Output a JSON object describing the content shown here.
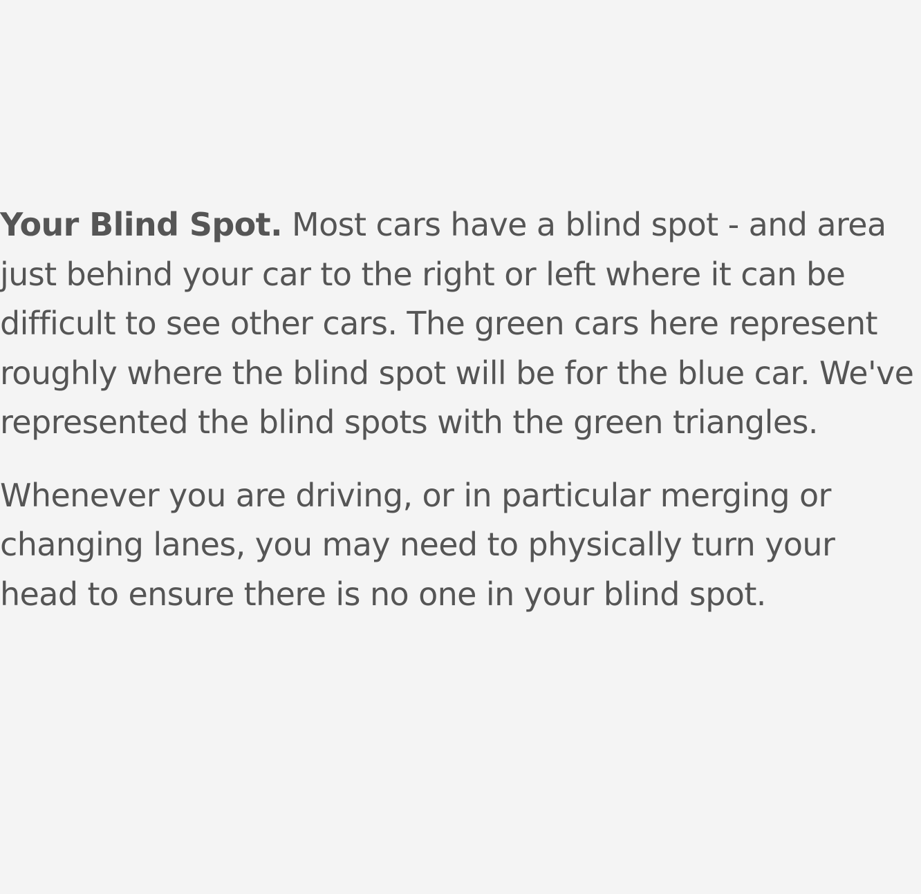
{
  "article": {
    "paragraph1": {
      "heading": "Your Blind Spot.",
      "text": "Most cars have a blind spot - and area just behind your car to the right or left where it can be difficult to see other cars. The green cars here represent roughly where the blind spot will be for the blue car. We've represented the blind spots with the green triangles."
    },
    "paragraph2": {
      "text": "Whenever you are driving, or in particular merging or changing lanes, you may need to physically turn your head to ensure there is no one in your blind spot."
    }
  },
  "colors": {
    "background": "#f4f4f4",
    "text": "#555555"
  }
}
